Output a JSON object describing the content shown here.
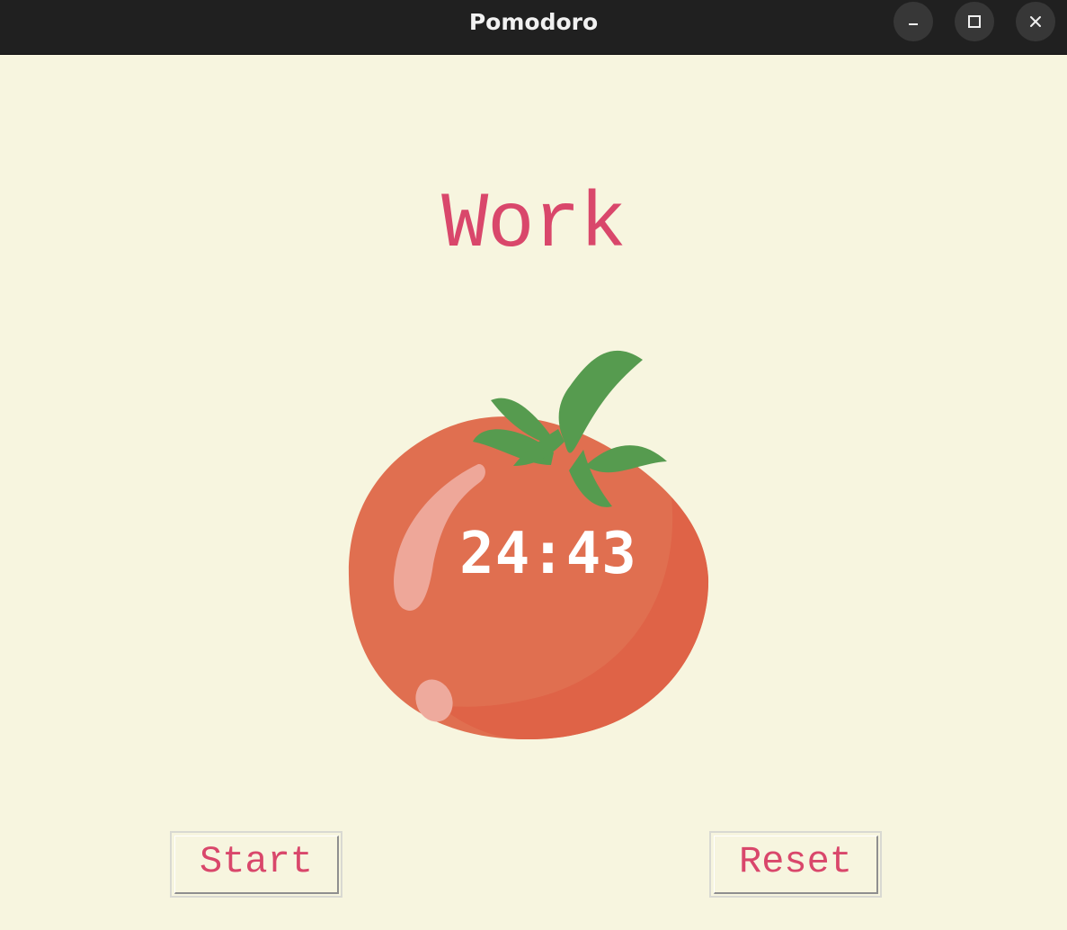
{
  "window": {
    "title": "Pomodoro"
  },
  "main": {
    "heading": "Work",
    "timer": "24:43",
    "tomato_icon": "tomato-icon"
  },
  "buttons": {
    "start_label": "Start",
    "reset_label": "Reset"
  },
  "colors": {
    "background": "#f7f5df",
    "accent_text": "#d9476b",
    "tomato": "#e06e4f",
    "leaf": "#539a52",
    "titlebar": "#202020"
  }
}
